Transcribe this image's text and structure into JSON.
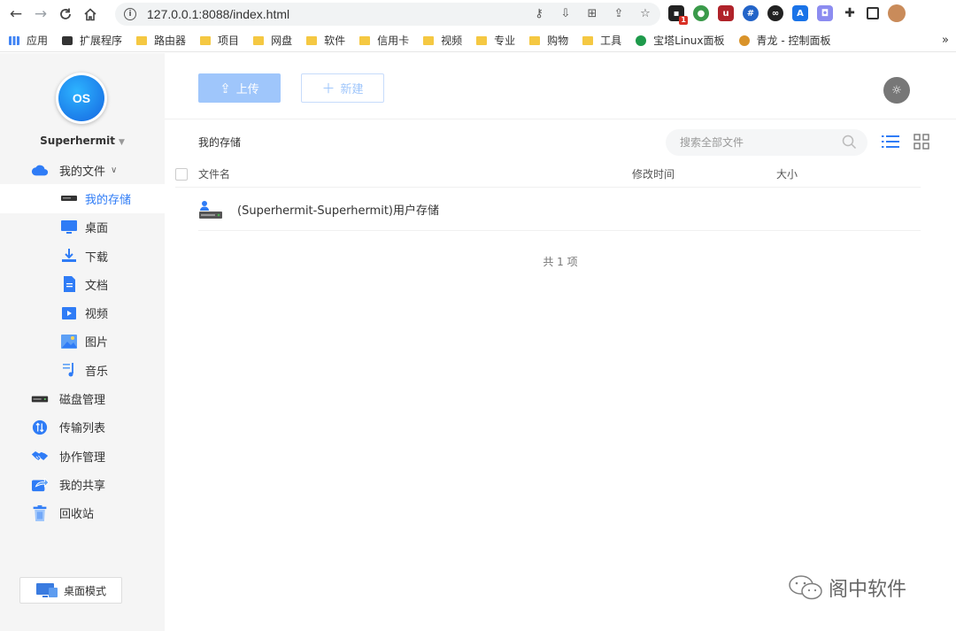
{
  "browser": {
    "url": "127.0.0.1:8088/index.html",
    "bookmarks": [
      {
        "label": "应用",
        "type": "apps"
      },
      {
        "label": "扩展程序",
        "type": "ext"
      },
      {
        "label": "路由器",
        "type": "folder"
      },
      {
        "label": "项目",
        "type": "folder"
      },
      {
        "label": "网盘",
        "type": "folder"
      },
      {
        "label": "软件",
        "type": "folder"
      },
      {
        "label": "信用卡",
        "type": "folder"
      },
      {
        "label": "视频",
        "type": "folder"
      },
      {
        "label": "专业",
        "type": "folder"
      },
      {
        "label": "购物",
        "type": "folder"
      },
      {
        "label": "工具",
        "type": "folder"
      },
      {
        "label": "宝塔Linux面板",
        "type": "site"
      },
      {
        "label": "青龙 - 控制面板",
        "type": "site"
      }
    ],
    "bookmarks_more": "»",
    "extension_badge": "1"
  },
  "sidebar": {
    "logo_text": "OS",
    "username": "Superhermit",
    "items": [
      {
        "label": "我的文件",
        "icon": "cloud-icon",
        "sub": false,
        "expandable": true
      },
      {
        "label": "我的存储",
        "icon": "storage-icon",
        "sub": true,
        "active": true
      },
      {
        "label": "桌面",
        "icon": "desktop-icon",
        "sub": true
      },
      {
        "label": "下载",
        "icon": "download-icon",
        "sub": true
      },
      {
        "label": "文档",
        "icon": "document-icon",
        "sub": true
      },
      {
        "label": "视频",
        "icon": "video-icon",
        "sub": true
      },
      {
        "label": "图片",
        "icon": "image-icon",
        "sub": true
      },
      {
        "label": "音乐",
        "icon": "music-icon",
        "sub": true
      },
      {
        "label": "磁盘管理",
        "icon": "disk-icon",
        "sub": false
      },
      {
        "label": "传输列表",
        "icon": "transfer-icon",
        "sub": false
      },
      {
        "label": "协作管理",
        "icon": "handshake-icon",
        "sub": false
      },
      {
        "label": "我的共享",
        "icon": "share-icon",
        "sub": false
      },
      {
        "label": "回收站",
        "icon": "trash-icon",
        "sub": false
      }
    ],
    "desktop_mode_label": "桌面模式"
  },
  "toolbar": {
    "upload_label": "上传",
    "new_label": "新建"
  },
  "main": {
    "breadcrumb": "我的存储",
    "search_placeholder": "搜索全部文件",
    "columns": {
      "name": "文件名",
      "modified": "修改时间",
      "size": "大小"
    },
    "rows": [
      {
        "name": "(Superhermit-Superhermit)用户存储",
        "modified": "",
        "size": ""
      }
    ],
    "total": "共 1 项"
  },
  "watermark": "阁中软件",
  "colors": {
    "accent": "#2f7cf6",
    "upload_bg": "#9fc6fb",
    "sidebar_bg": "#f5f5f5"
  }
}
